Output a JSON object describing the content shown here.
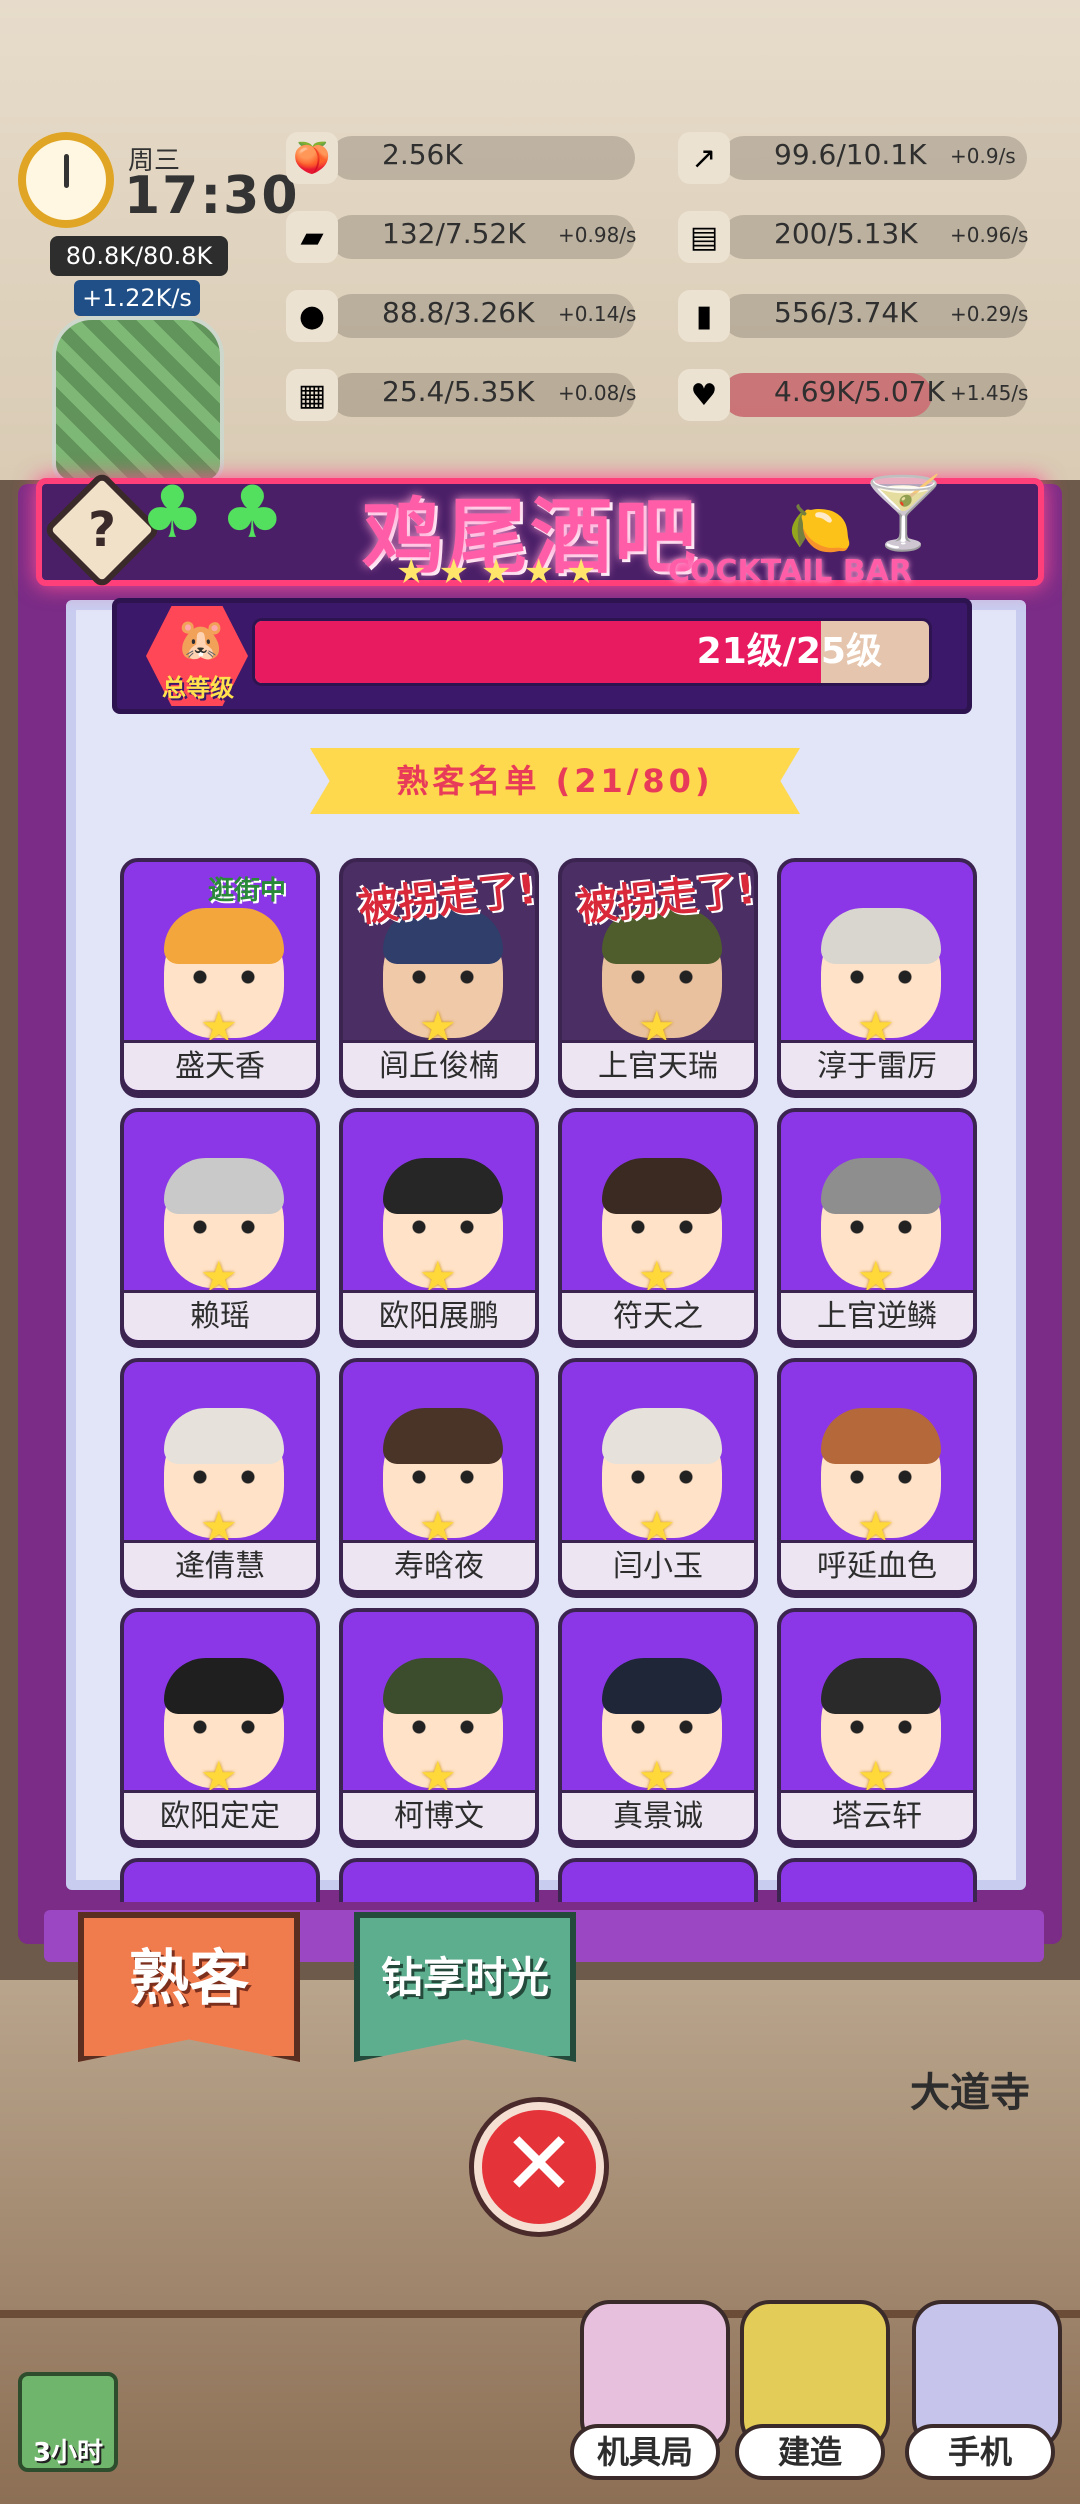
{
  "hud": {
    "day": "周三",
    "time": "17:30",
    "cash_cap": "80.8K/80.8K",
    "cash_rate": "+1.22K/s",
    "resources_left": [
      {
        "icon": "peach-icon",
        "value": "2.56K",
        "rate": ""
      },
      {
        "icon": "gold-bar-icon",
        "value": "132/7.52K",
        "rate": "+0.98/s"
      },
      {
        "icon": "coal-icon",
        "value": "88.8/3.26K",
        "rate": "+0.14/s"
      },
      {
        "icon": "chocolate-icon",
        "value": "25.4/5.35K",
        "rate": "+0.08/s"
      }
    ],
    "resources_right": [
      {
        "icon": "chart-icon",
        "value": "99.6/10.1K",
        "rate": "+0.9/s"
      },
      {
        "icon": "book-icon",
        "value": "200/5.13K",
        "rate": "+0.96/s"
      },
      {
        "icon": "bottle-icon",
        "value": "556/3.74K",
        "rate": "+0.29/s"
      },
      {
        "icon": "heart-icon",
        "value": "4.69K/5.07K",
        "rate": "+1.45/s"
      }
    ]
  },
  "panel": {
    "title": "鸡尾酒吧",
    "subtitle": "COCKTAIL BAR",
    "stars": "★★★★★",
    "help": "?",
    "level_label": "总等级",
    "level_text": "21级/25级",
    "level_progress": 0.84,
    "list_title": "熟客名单 (21/80)"
  },
  "customers": [
    {
      "name": "盛天香",
      "status": "逛街中",
      "stamp": "",
      "hair": "#f2a63b",
      "skin": "#ffe2c7",
      "dim": false
    },
    {
      "name": "闾丘俊楠",
      "status": "",
      "stamp": "被拐走了!",
      "hair": "#2f3e6b",
      "skin": "#f0c9a8",
      "dim": true
    },
    {
      "name": "上官天瑞",
      "status": "",
      "stamp": "被拐走了!",
      "hair": "#4f5d2d",
      "skin": "#e9c19e",
      "dim": true
    },
    {
      "name": "淳于雷厉",
      "status": "",
      "stamp": "",
      "hair": "#d9d6cf",
      "skin": "#ffe2c7",
      "dim": false
    },
    {
      "name": "赖瑶",
      "status": "",
      "stamp": "",
      "hair": "#c9c9c9",
      "skin": "#ffe2c7",
      "dim": false
    },
    {
      "name": "欧阳展鹏",
      "status": "",
      "stamp": "",
      "hair": "#262626",
      "skin": "#ffe2c7",
      "dim": false
    },
    {
      "name": "符天之",
      "status": "",
      "stamp": "",
      "hair": "#3a2a22",
      "skin": "#ffe2c7",
      "dim": false
    },
    {
      "name": "上官逆鳞",
      "status": "",
      "stamp": "",
      "hair": "#8e8e8e",
      "skin": "#ffe2c7",
      "dim": false
    },
    {
      "name": "逄倩慧",
      "status": "",
      "stamp": "",
      "hair": "#e6e1da",
      "skin": "#ffe2c7",
      "dim": false
    },
    {
      "name": "寿晗夜",
      "status": "",
      "stamp": "",
      "hair": "#4a3428",
      "skin": "#ffe2c7",
      "dim": false
    },
    {
      "name": "闫小玉",
      "status": "",
      "stamp": "",
      "hair": "#e6e1da",
      "skin": "#ffe2c7",
      "dim": false
    },
    {
      "name": "呼延血色",
      "status": "",
      "stamp": "",
      "hair": "#b5693a",
      "skin": "#ffe2c7",
      "dim": false
    },
    {
      "name": "欧阳定定",
      "status": "",
      "stamp": "",
      "hair": "#1f1f1f",
      "skin": "#ffe2c7",
      "dim": false
    },
    {
      "name": "柯博文",
      "status": "",
      "stamp": "",
      "hair": "#3b4d2c",
      "skin": "#ffe2c7",
      "dim": false
    },
    {
      "name": "真景诚",
      "status": "",
      "stamp": "",
      "hair": "#1f2638",
      "skin": "#ffe2c7",
      "dim": false
    },
    {
      "name": "塔云轩",
      "status": "",
      "stamp": "",
      "hair": "#2a2a2a",
      "skin": "#ffe2c7",
      "dim": false
    }
  ],
  "tabs": {
    "regulars": "熟客",
    "vip": "钻享时光"
  },
  "close_label": "✕",
  "street_sign": "大道寺",
  "timer": "3小时",
  "nav": [
    {
      "label": "机具局",
      "color": "#e7c0dd"
    },
    {
      "label": "建造",
      "color": "#e3cc57"
    },
    {
      "label": "手机",
      "color": "#c6c4ea"
    }
  ]
}
